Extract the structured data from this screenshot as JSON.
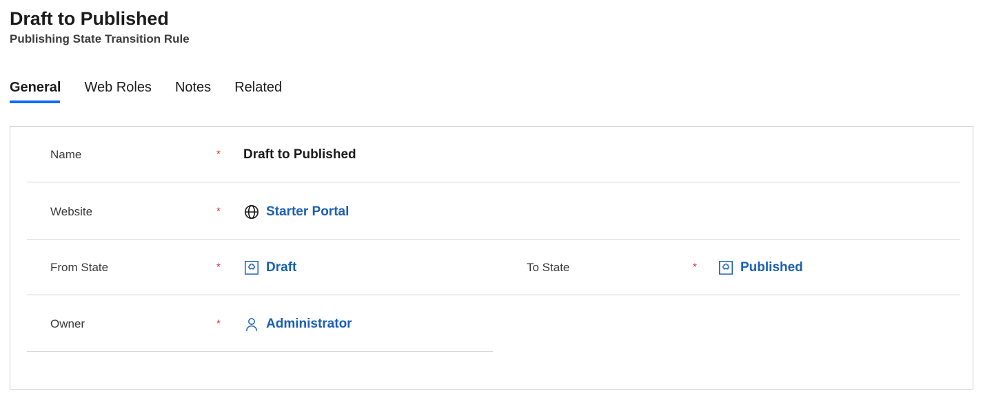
{
  "header": {
    "title": "Draft to Published",
    "subtitle": "Publishing State Transition Rule"
  },
  "tabs": [
    {
      "label": "General",
      "active": true
    },
    {
      "label": "Web Roles",
      "active": false
    },
    {
      "label": "Notes",
      "active": false
    },
    {
      "label": "Related",
      "active": false
    }
  ],
  "form": {
    "required_marker": "*",
    "rows": [
      {
        "name": {
          "label": "Name",
          "required": true,
          "value": "Draft to Published",
          "value_type": "text",
          "icon": null
        }
      },
      {
        "website": {
          "label": "Website",
          "required": true,
          "value": "Starter Portal",
          "value_type": "link",
          "icon": "globe-icon"
        }
      },
      {
        "from_state": {
          "label": "From State",
          "required": true,
          "value": "Draft",
          "value_type": "link",
          "icon": "entity-icon"
        },
        "to_state": {
          "label": "To State",
          "required": true,
          "value": "Published",
          "value_type": "link",
          "icon": "entity-icon"
        }
      },
      {
        "owner": {
          "label": "Owner",
          "required": true,
          "value": "Administrator",
          "value_type": "link",
          "icon": "person-icon"
        }
      }
    ]
  },
  "colors": {
    "accent": "#0f6cf7",
    "link": "#1a5fb4",
    "required": "#d13438",
    "label": "#393939",
    "title": "#1b1b1b",
    "subtitle": "#3c3c3c",
    "border": "#cfcfcf",
    "divider": "#d3d3d3"
  }
}
